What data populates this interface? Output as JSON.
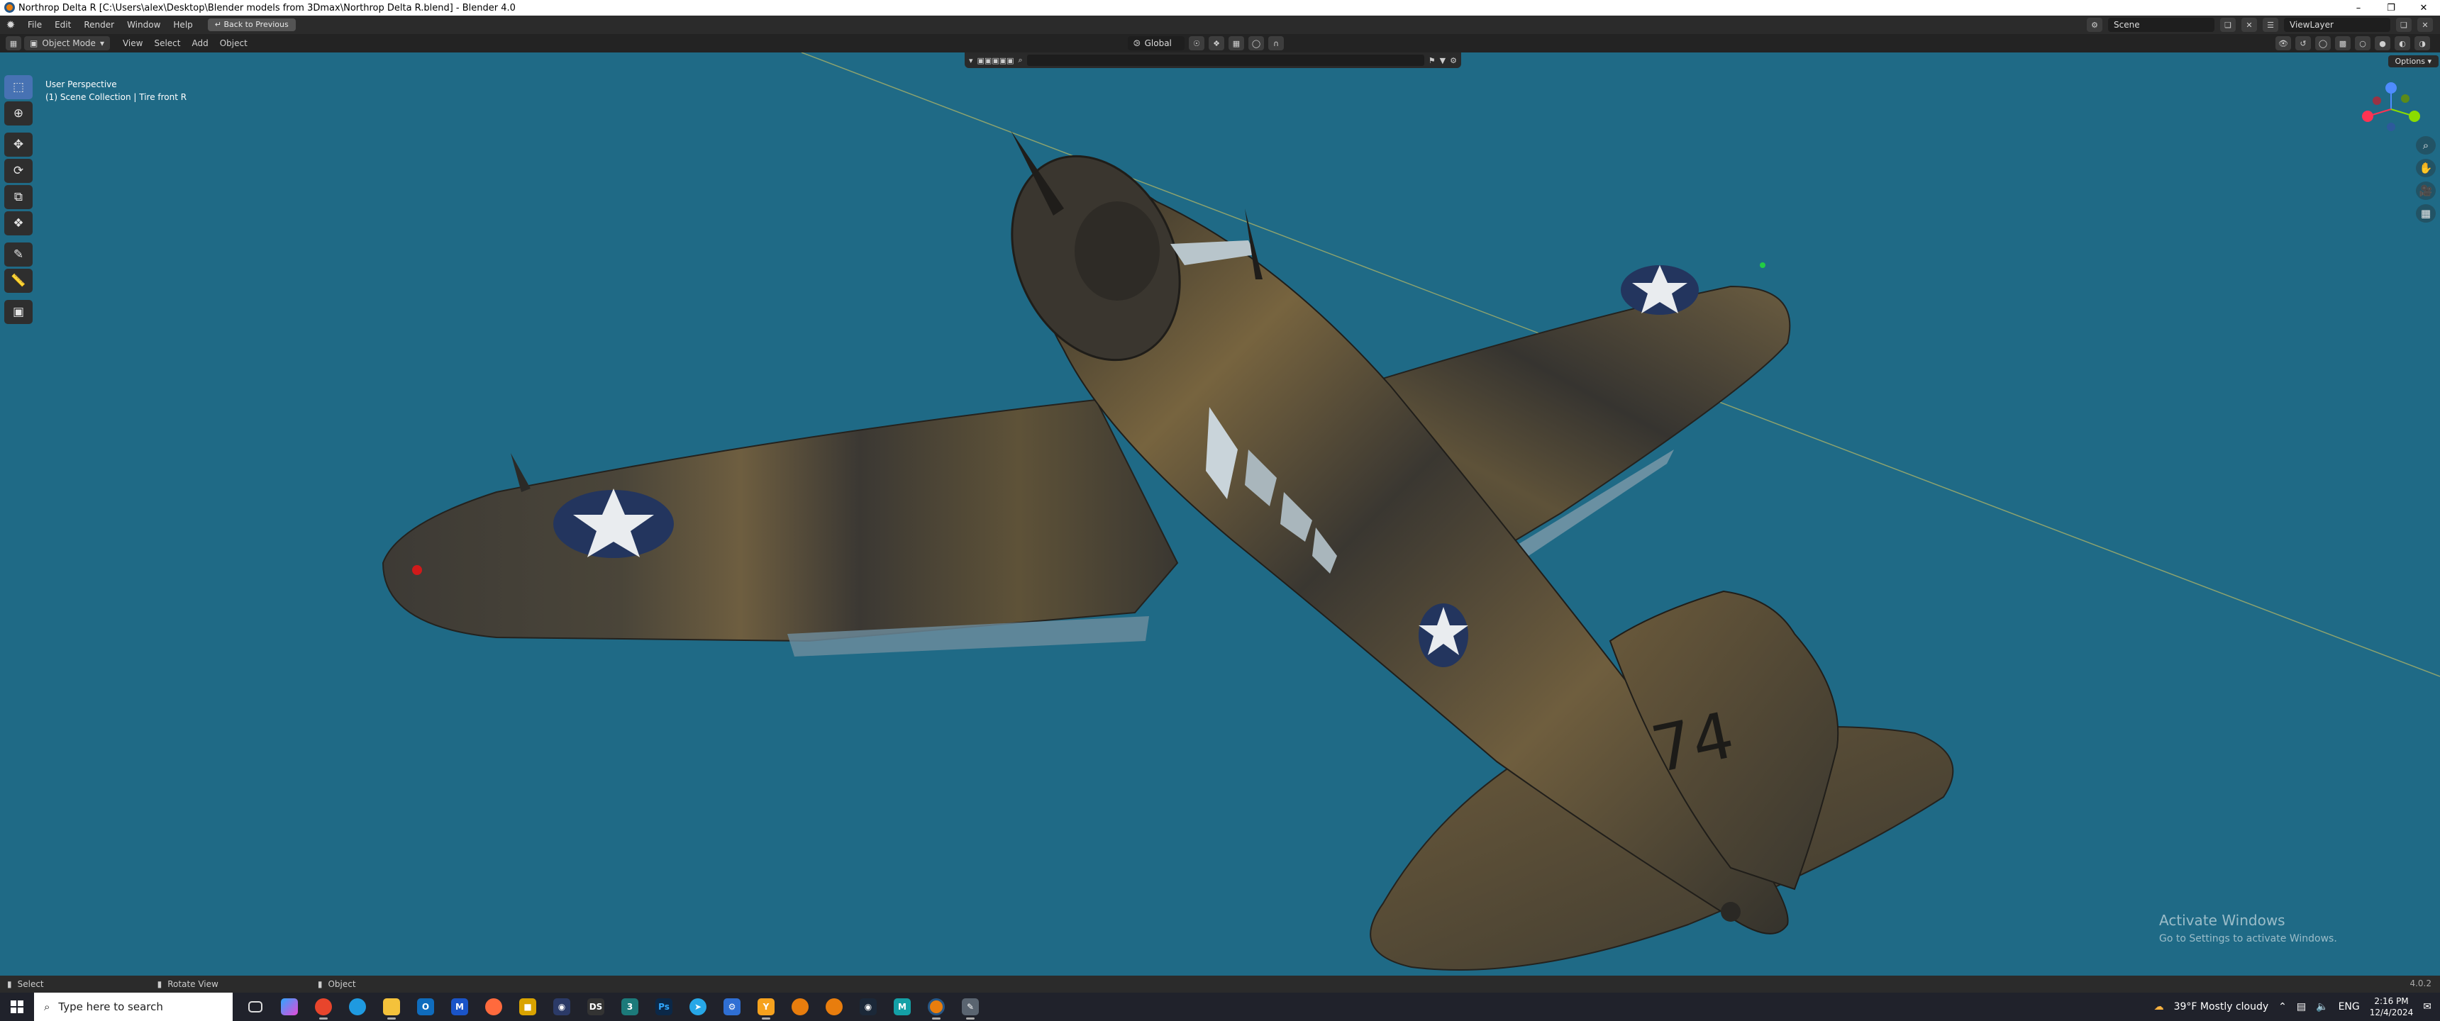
{
  "window": {
    "title": "Northrop Delta  R [C:\\Users\\alex\\Desktop\\Blender models from 3Dmax\\Northrop Delta  R.blend] - Blender 4.0",
    "minimize": "–",
    "maximize": "❐",
    "close": "✕"
  },
  "menubar": {
    "items": [
      "File",
      "Edit",
      "Render",
      "Window",
      "Help"
    ],
    "back_button": "Back to Previous",
    "scene_field": "Scene",
    "viewlayer_field": "ViewLayer"
  },
  "viewport_header": {
    "mode": "Object Mode",
    "menus": [
      "View",
      "Select",
      "Add",
      "Object"
    ],
    "transform_orientation": "Global",
    "options_button": "Options"
  },
  "viewport": {
    "perspective_label": "User Perspective",
    "collection_label": "(1) Scene Collection | Tire front R",
    "background_color": "#1f6a86",
    "aircraft_number": "74",
    "gizmo_axes": [
      "X",
      "Y",
      "Z"
    ],
    "activate_title": "Activate Windows",
    "activate_sub": "Go to Settings to activate Windows."
  },
  "toolbar": {
    "tools": [
      "select-box-icon",
      "cursor-icon",
      "move-icon",
      "rotate-icon",
      "scale-icon",
      "transform-icon",
      "annotate-icon",
      "measure-icon",
      "add-cube-icon"
    ]
  },
  "statusbar": {
    "select": "Select",
    "rotate_view": "Rotate View",
    "object": "Object",
    "version": "4.0.2"
  },
  "taskbar": {
    "search_placeholder": "Type here to search",
    "weather": "39°F  Mostly cloudy",
    "language": "ENG",
    "time": "2:16 PM",
    "date": "12/4/2024",
    "notification_count": "1"
  }
}
